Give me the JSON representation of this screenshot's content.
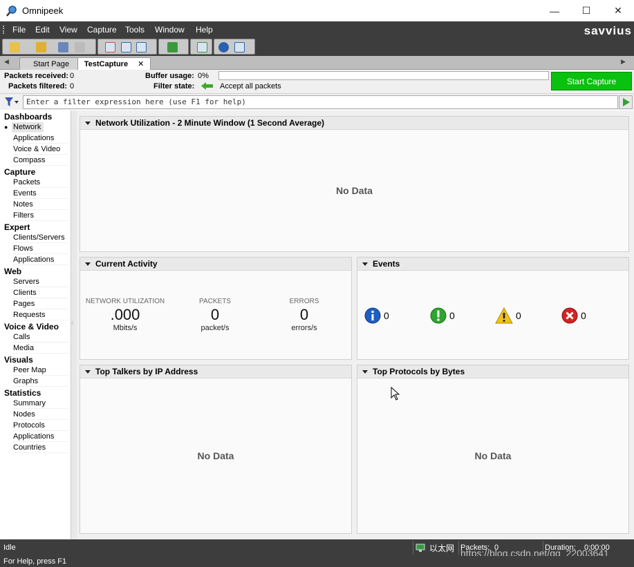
{
  "window": {
    "title": "Omnipeek",
    "minimize": "—",
    "maximize": "☐",
    "close": "✕"
  },
  "menu": {
    "items": [
      "File",
      "Edit",
      "View",
      "Capture",
      "Tools",
      "Window",
      "Help"
    ],
    "brand": "savvius"
  },
  "tabs": [
    {
      "label": "Start Page"
    },
    {
      "label": "TestCapture",
      "close": "✕"
    }
  ],
  "status": {
    "packets_received_label": "Packets received:",
    "packets_received": "0",
    "packets_filtered_label": "Packets filtered:",
    "packets_filtered": "0",
    "buffer_usage_label": "Buffer usage:",
    "buffer_usage": "0%",
    "filter_state_label": "Filter state:",
    "filter_state": "Accept all packets",
    "start_capture": "Start Capture"
  },
  "filter": {
    "placeholder": "Enter a filter expression here (use F1 for help)"
  },
  "sidebar": {
    "sections": [
      {
        "title": "Dashboards",
        "items": [
          "Network",
          "Applications",
          "Voice & Video",
          "Compass"
        ]
      },
      {
        "title": "Capture",
        "items": [
          "Packets",
          "Events",
          "Notes",
          "Filters"
        ]
      },
      {
        "title": "Expert",
        "items": [
          "Clients/Servers",
          "Flows",
          "Applications"
        ]
      },
      {
        "title": "Web",
        "items": [
          "Servers",
          "Clients",
          "Pages",
          "Requests"
        ]
      },
      {
        "title": "Voice & Video",
        "items": [
          "Calls",
          "Media"
        ]
      },
      {
        "title": "Visuals",
        "items": [
          "Peer Map",
          "Graphs"
        ]
      },
      {
        "title": "Statistics",
        "items": [
          "Summary",
          "Nodes",
          "Protocols",
          "Applications",
          "Countries"
        ]
      }
    ],
    "selected": "Network",
    "bullet": "●"
  },
  "panels": {
    "utilization": {
      "title": "Network Utilization - 2 Minute Window (1 Second Average)",
      "nodata": "No Data"
    },
    "activity": {
      "title": "Current Activity",
      "metrics": [
        {
          "label": "NETWORK UTILIZATION",
          "value": ".000",
          "unit": "Mbits/s"
        },
        {
          "label": "PACKETS",
          "value": "0",
          "unit": "packet/s"
        },
        {
          "label": "ERRORS",
          "value": "0",
          "unit": "errors/s"
        }
      ]
    },
    "events": {
      "title": "Events",
      "items": [
        {
          "icon": "info-icon",
          "count": "0",
          "color": "#1e5fc2"
        },
        {
          "icon": "notice-icon",
          "count": "0",
          "color": "#2ea52e"
        },
        {
          "icon": "warning-icon",
          "count": "0",
          "color": "#f1c21b"
        },
        {
          "icon": "error-icon",
          "count": "0",
          "color": "#d32323"
        }
      ]
    },
    "talkers": {
      "title": "Top Talkers by IP Address",
      "nodata": "No Data"
    },
    "protocols": {
      "title": "Top Protocols by Bytes",
      "nodata": "No Data"
    }
  },
  "statusbar": {
    "state": "Idle",
    "adapter": "以太网",
    "packets_label": "Packets:",
    "packets": "0",
    "duration_label": "Duration:",
    "duration": "0:00:00",
    "watermark": "https://blog.csdn.net/qq_22003641"
  },
  "helpbar": {
    "text": "For Help, press F1"
  },
  "colors": {
    "accent_green": "#09c10e",
    "dark_bar": "#3d3d3d"
  }
}
